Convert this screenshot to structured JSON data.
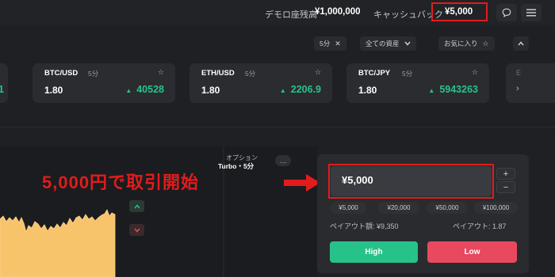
{
  "topbar": {
    "balance_label": "デモロ座残高",
    "balance_value": "¥1,000,000",
    "cashback_label": "キャッシュバック",
    "cashback_value": "¥5,000",
    "chat_icon": "chat-bubble-icon",
    "menu_icon": "hamburger-menu-icon"
  },
  "filters": {
    "timeframe": "5分",
    "assets": "全ての資産",
    "favorites": "お気に入り"
  },
  "cards": [
    {
      "pair": "BTC/USD",
      "timeframe": "5分",
      "payout": "1.80",
      "price": "40528"
    },
    {
      "pair": "ETH/USD",
      "timeframe": "5分",
      "payout": "1.80",
      "price": "2206.9"
    },
    {
      "pair": "BTC/JPY",
      "timeframe": "5分",
      "payout": "1.80",
      "price": "5943263"
    }
  ],
  "partial_cards": {
    "left_value": "1",
    "right_label": "E"
  },
  "option": {
    "label": "オプション",
    "mode": "Turbo・5分",
    "more": "…"
  },
  "annotation": {
    "text": "5,000円で取引開始"
  },
  "trade": {
    "amount": "¥5,000",
    "presets": [
      "¥5,000",
      "¥20,000",
      "¥50,000",
      "¥100,000"
    ],
    "payout_amount": "ペイアウト額: ¥9,350",
    "payout_rate": "ペイアウト: 1.87",
    "high_label": "High",
    "low_label": "Low"
  },
  "colors": {
    "background": "#1f2023",
    "positive": "#27c28a",
    "negative": "#e8495f",
    "annotation_red": "#e11c1c",
    "chart_fill": "#f7c46c"
  }
}
